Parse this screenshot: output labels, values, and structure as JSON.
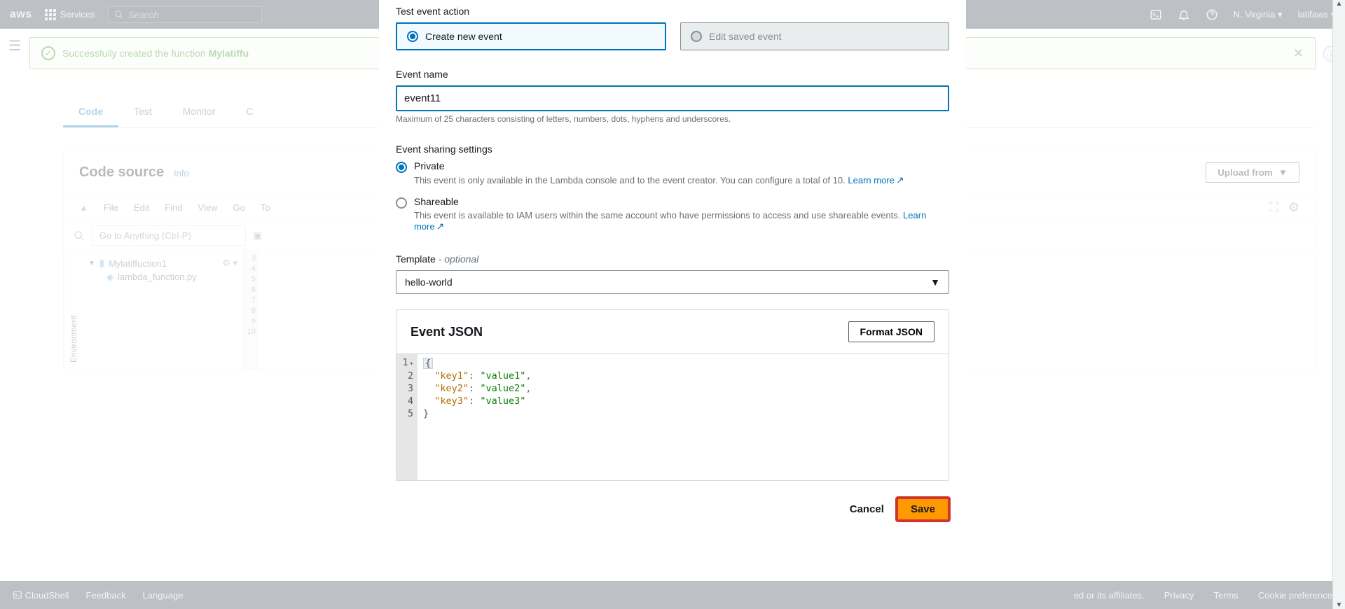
{
  "nav": {
    "logo": "aws",
    "services": "Services",
    "search_placeholder": "Search",
    "region": "N. Virginia",
    "account": "latifaws"
  },
  "banner": {
    "prefix": "Successfully created the function ",
    "fn_name": "Mylatiffu"
  },
  "tabs": [
    "Code",
    "Test",
    "Monitor",
    "C"
  ],
  "codeSection": {
    "title": "Code source",
    "info": "Info",
    "upload": "Upload from"
  },
  "editor": {
    "menu": [
      "File",
      "Edit",
      "Find",
      "View",
      "Go",
      "To"
    ],
    "goto_placeholder": "Go to Anything (Ctrl-P)",
    "env_label": "Environment",
    "folder": "Mylatiffuction1",
    "file": "lambda_function.py"
  },
  "footer": {
    "cloudshell": "CloudShell",
    "feedback": "Feedback",
    "language": "Language",
    "affiliates": "ed or its affiliates.",
    "privacy": "Privacy",
    "terms": "Terms",
    "cookie": "Cookie preference"
  },
  "modal": {
    "testEventActionLabel": "Test event action",
    "createNew": "Create new event",
    "editSaved": "Edit saved event",
    "eventNameLabel": "Event name",
    "eventNameValue": "event11",
    "eventNameHelper": "Maximum of 25 characters consisting of letters, numbers, dots, hyphens and underscores.",
    "sharingLabel": "Event sharing settings",
    "private": {
      "title": "Private",
      "desc": "This event is only available in the Lambda console and to the event creator. You can configure a total of 10.",
      "learn": "Learn more"
    },
    "shareable": {
      "title": "Shareable",
      "desc": "This event is available to IAM users within the same account who have permissions to access and use shareable events.",
      "learn": "Learn more"
    },
    "templateLabel": "Template",
    "templateOptional": "- optional",
    "templateValue": "hello-world",
    "jsonTitle": "Event JSON",
    "formatBtn": "Format JSON",
    "jsonLines": {
      "l1a": "{",
      "l2k": "\"key1\"",
      "l2c": ": ",
      "l2v": "\"value1\"",
      "l2e": ",",
      "l3k": "\"key2\"",
      "l3c": ": ",
      "l3v": "\"value2\"",
      "l3e": ",",
      "l4k": "\"key3\"",
      "l4c": ": ",
      "l4v": "\"value3\"",
      "l5a": "}"
    },
    "cancel": "Cancel",
    "save": "Save"
  }
}
